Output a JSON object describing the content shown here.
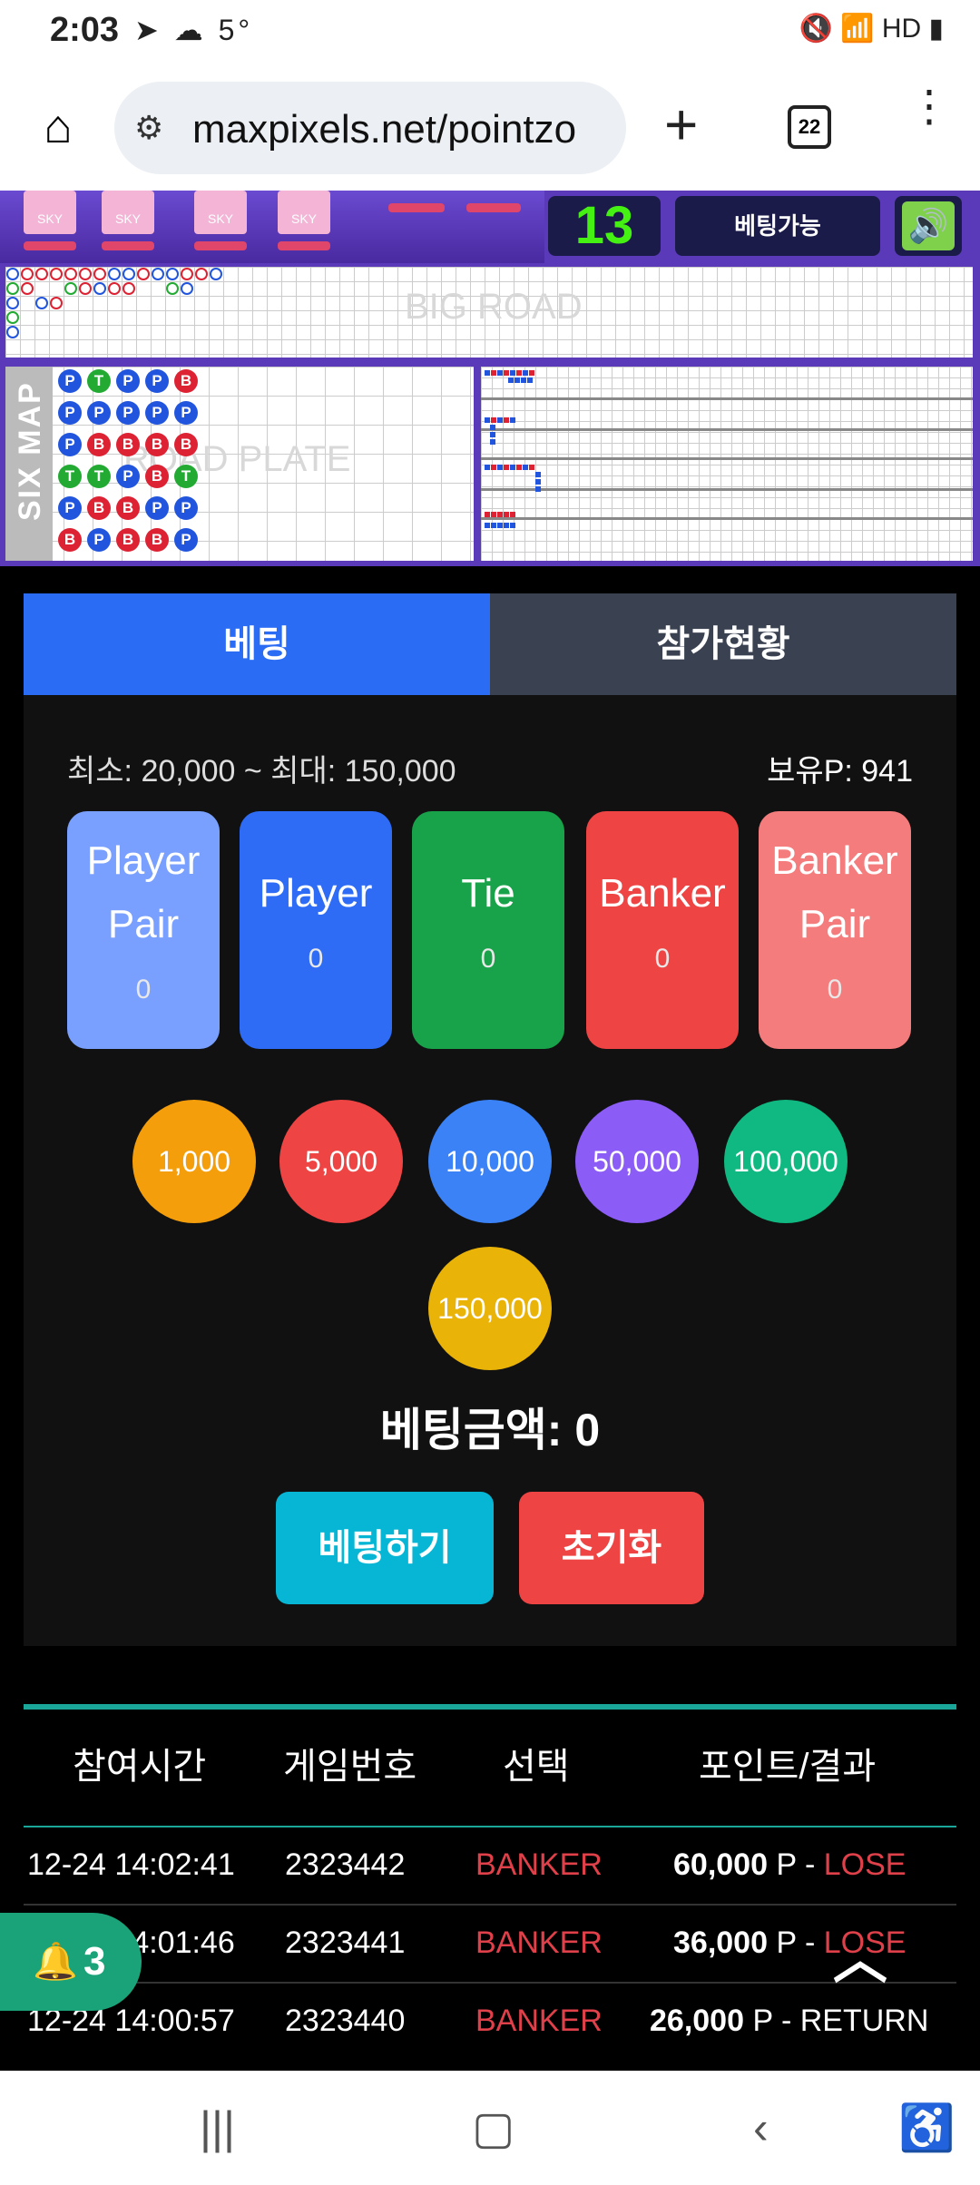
{
  "status_bar": {
    "time": "2:03",
    "temp": "5°",
    "icons_right": "🔇 📶 HD ▮"
  },
  "browser": {
    "url": "maxpixels.net/pointzo",
    "tab_count": "22"
  },
  "game": {
    "counter": "13",
    "bet_state": "베팅가능",
    "big_road_label": "BIG ROAD",
    "bead_label": "ROAD PLATE",
    "six_map_label": "SIX MAP",
    "card_label": "SKY",
    "bead_plate": [
      [
        "P",
        "T",
        "P",
        "P",
        "B"
      ],
      [
        "P",
        "P",
        "P",
        "P",
        "P"
      ],
      [
        "P",
        "B",
        "B",
        "B",
        "B"
      ],
      [
        "T",
        "T",
        "P",
        "B",
        "T"
      ],
      [
        "P",
        "B",
        "B",
        "P",
        "P"
      ],
      [
        "B",
        "P",
        "B",
        "B",
        "P"
      ]
    ]
  },
  "tabs": {
    "betting": "베팅",
    "participants": "참가현황"
  },
  "limits": {
    "text": "최소: 20,000 ~ 최대: 150,000",
    "points": "보유P: 941"
  },
  "bet_options": [
    {
      "line1": "Player",
      "line2": "Pair",
      "amount": "0",
      "color": "#7aa0ff"
    },
    {
      "line1": "Player",
      "line2": "",
      "amount": "0",
      "color": "#2e6cf6"
    },
    {
      "line1": "Tie",
      "line2": "",
      "amount": "0",
      "color": "#18a34a"
    },
    {
      "line1": "Banker",
      "line2": "",
      "amount": "0",
      "color": "#ef4444"
    },
    {
      "line1": "Banker",
      "line2": "Pair",
      "amount": "0",
      "color": "#f47c7c"
    }
  ],
  "chips": [
    {
      "label": "1,000",
      "color": "#f59e0b"
    },
    {
      "label": "5,000",
      "color": "#ef4444"
    },
    {
      "label": "10,000",
      "color": "#3b82f6"
    },
    {
      "label": "50,000",
      "color": "#8b5cf6"
    },
    {
      "label": "100,000",
      "color": "#10b981"
    },
    {
      "label": "150,000",
      "color": "#eab308"
    }
  ],
  "total": {
    "label": "베팅금액: 0"
  },
  "actions": {
    "bet": "베팅하기",
    "reset": "초기화"
  },
  "history": {
    "headers": [
      "참여시간",
      "게임번호",
      "선택",
      "포인트/결과"
    ],
    "rows": [
      {
        "time": "12-24 14:02:41",
        "game": "2323442",
        "choice": "BANKER",
        "points": "60,000",
        "unit": "P - ",
        "result": "LOSE"
      },
      {
        "time": "12-24 14:01:46",
        "game": "2323441",
        "choice": "BANKER",
        "points": "36,000",
        "unit": "P - ",
        "result": "LOSE"
      },
      {
        "time": "12-24 14:00:57",
        "game": "2323440",
        "choice": "BANKER",
        "points": "26,000",
        "unit": "P - ",
        "result": "RETURN"
      }
    ]
  },
  "notifications": {
    "count": "3"
  }
}
